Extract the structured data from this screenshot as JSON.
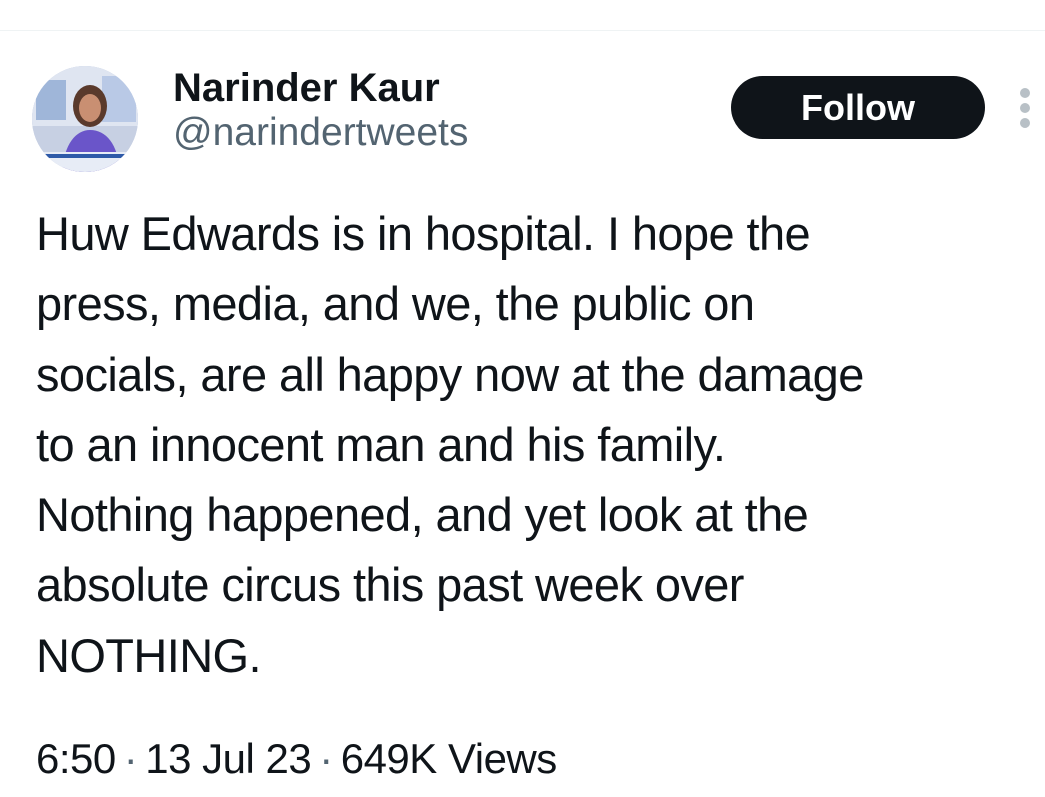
{
  "author": {
    "display_name": "Narinder Kaur",
    "handle": "@narindertweets",
    "avatar_icon": "user-avatar-photo"
  },
  "actions": {
    "follow_label": "Follow",
    "more_icon": "more-options-icon"
  },
  "tweet": {
    "lines": [
      "Huw Edwards is in hospital. I hope the",
      "press, media, and we, the public on",
      "socials, are all happy now at the damage",
      "to an innocent man and his family.",
      "Nothing happened, and yet look at the",
      "absolute circus this past week over",
      "NOTHING."
    ]
  },
  "meta": {
    "time": "6:50",
    "date": "13 Jul 23",
    "views": "649K Views",
    "separator": "·"
  },
  "colors": {
    "text": "#0f1419",
    "secondary": "#536471",
    "button_bg": "#0f1419",
    "button_text": "#ffffff",
    "divider": "#eff3f4"
  }
}
